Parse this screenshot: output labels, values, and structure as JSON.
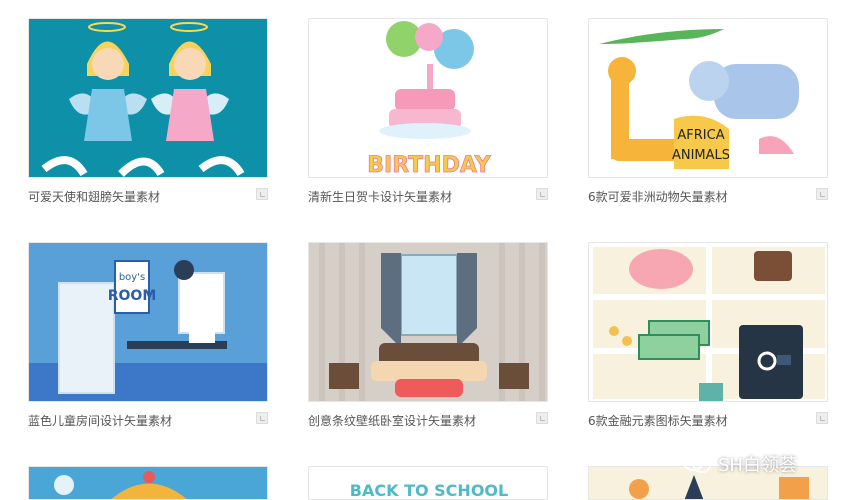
{
  "cards": [
    {
      "caption": "可爱天使和翅膀矢量素材"
    },
    {
      "caption": "清新生日贺卡设计矢量素材",
      "thumb_text": "BIRTHDAY"
    },
    {
      "caption": "6款可爱非洲动物矢量素材",
      "thumb_text": "AFRICA ANIMALS",
      "thumb_text_lines": [
        "AFRICA",
        "ANIMALS"
      ]
    },
    {
      "caption": "蓝色儿童房间设计矢量素材",
      "thumb_text_lines": [
        "boy's",
        "ROOM"
      ]
    },
    {
      "caption": "创意条纹壁纸卧室设计矢量素材"
    },
    {
      "caption": "6款金融元素图标矢量素材"
    },
    {
      "caption": ""
    },
    {
      "caption": "",
      "thumb_text": "BACK TO SCHOOL"
    },
    {
      "caption": ""
    }
  ],
  "watermark": {
    "text": "SH白领荟",
    "icon": "wechat-icon"
  },
  "colors": {
    "teal": "#0e90a9",
    "wall_blue": "#5aa0d8",
    "card_bg_beige": "#f7f1dd"
  }
}
